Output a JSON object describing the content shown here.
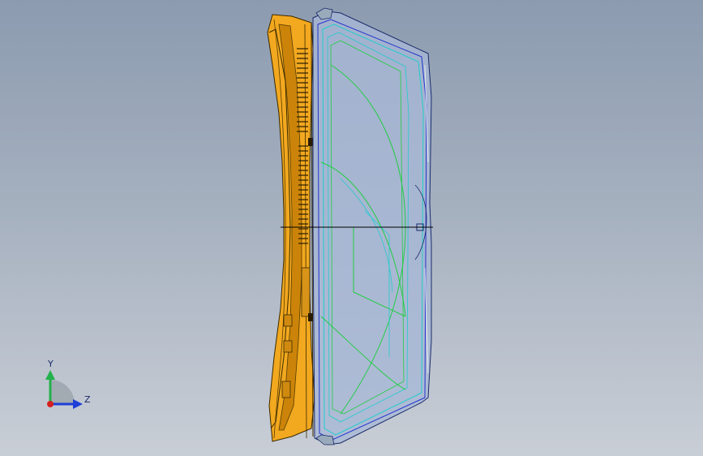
{
  "viewport": {
    "background_top": "#8c9bb0",
    "background_bottom": "#c9ced6"
  },
  "model": {
    "bezel_color": "#f2a81f",
    "bezel_dark": "#c57e06",
    "glass_color": "#a8b8d6",
    "edge_blue": "#2233cc",
    "edge_cyan": "#22cccc",
    "edge_green": "#22cc44"
  },
  "triad": {
    "y_label": "Y",
    "z_label": "Z",
    "y_color": "#22b14c",
    "z_color": "#1f3fd6",
    "x_color": "#d62020"
  }
}
